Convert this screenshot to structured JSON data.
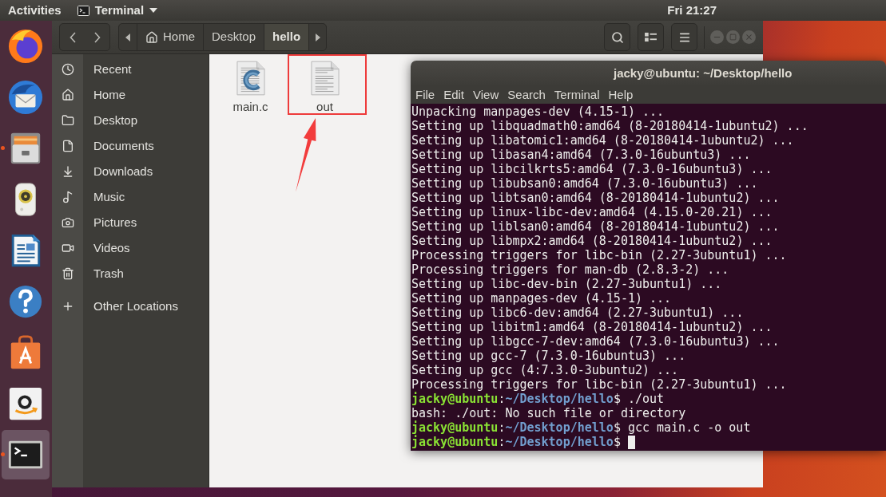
{
  "top_bar": {
    "activities": "Activities",
    "app_menu": "Terminal",
    "clock": "Fri 21:27"
  },
  "dock": {
    "items": [
      {
        "running": false,
        "selected": false
      },
      {
        "running": false,
        "selected": false
      },
      {
        "running": true,
        "selected": false
      },
      {
        "running": false,
        "selected": false
      },
      {
        "running": false,
        "selected": false
      },
      {
        "running": false,
        "selected": false
      },
      {
        "running": false,
        "selected": false
      },
      {
        "running": false,
        "selected": false
      },
      {
        "running": true,
        "selected": true
      }
    ]
  },
  "file_manager": {
    "path_bar": [
      {
        "kind": "home",
        "label": "Home",
        "selected": false
      },
      {
        "kind": "folder",
        "label": "Desktop",
        "selected": false
      },
      {
        "kind": "folder",
        "label": "hello",
        "selected": true
      }
    ],
    "sidebar": {
      "places": [
        "Recent",
        "Home",
        "Desktop",
        "Documents",
        "Downloads",
        "Music",
        "Pictures",
        "Videos",
        "Trash"
      ],
      "other_locations": "Other Locations"
    },
    "files": [
      {
        "name": "main.c",
        "kind": "c-source"
      },
      {
        "name": "out",
        "kind": "text"
      }
    ]
  },
  "terminal": {
    "title": "jacky@ubuntu: ~/Desktop/hello",
    "menu": [
      "File",
      "Edit",
      "View",
      "Search",
      "Terminal",
      "Help"
    ],
    "lines": [
      {
        "kind": "output",
        "text": "Unpacking manpages-dev (4.15-1) ..."
      },
      {
        "kind": "output",
        "text": "Setting up libquadmath0:amd64 (8-20180414-1ubuntu2) ..."
      },
      {
        "kind": "output",
        "text": "Setting up libatomic1:amd64 (8-20180414-1ubuntu2) ..."
      },
      {
        "kind": "output",
        "text": "Setting up libasan4:amd64 (7.3.0-16ubuntu3) ..."
      },
      {
        "kind": "output",
        "text": "Setting up libcilkrts5:amd64 (7.3.0-16ubuntu3) ..."
      },
      {
        "kind": "output",
        "text": "Setting up libubsan0:amd64 (7.3.0-16ubuntu3) ..."
      },
      {
        "kind": "output",
        "text": "Setting up libtsan0:amd64 (8-20180414-1ubuntu2) ..."
      },
      {
        "kind": "output",
        "text": "Setting up linux-libc-dev:amd64 (4.15.0-20.21) ..."
      },
      {
        "kind": "output",
        "text": "Setting up liblsan0:amd64 (8-20180414-1ubuntu2) ..."
      },
      {
        "kind": "output",
        "text": "Setting up libmpx2:amd64 (8-20180414-1ubuntu2) ..."
      },
      {
        "kind": "output",
        "text": "Processing triggers for libc-bin (2.27-3ubuntu1) ..."
      },
      {
        "kind": "output",
        "text": "Processing triggers for man-db (2.8.3-2) ..."
      },
      {
        "kind": "output",
        "text": "Setting up libc-dev-bin (2.27-3ubuntu1) ..."
      },
      {
        "kind": "output",
        "text": "Setting up manpages-dev (4.15-1) ..."
      },
      {
        "kind": "output",
        "text": "Setting up libc6-dev:amd64 (2.27-3ubuntu1) ..."
      },
      {
        "kind": "output",
        "text": "Setting up libitm1:amd64 (8-20180414-1ubuntu2) ..."
      },
      {
        "kind": "output",
        "text": "Setting up libgcc-7-dev:amd64 (7.3.0-16ubuntu3) ..."
      },
      {
        "kind": "output",
        "text": "Setting up gcc-7 (7.3.0-16ubuntu3) ..."
      },
      {
        "kind": "output",
        "text": "Setting up gcc (4:7.3.0-3ubuntu2) ..."
      },
      {
        "kind": "output",
        "text": "Processing triggers for libc-bin (2.27-3ubuntu1) ..."
      },
      {
        "kind": "prompt",
        "user": "jacky@ubuntu",
        "separator": ":",
        "path": "~/Desktop/hello",
        "symbol": "$",
        "command": "./out",
        "cursor": false
      },
      {
        "kind": "output",
        "text": "bash: ./out: No such file or directory"
      },
      {
        "kind": "prompt",
        "user": "jacky@ubuntu",
        "separator": ":",
        "path": "~/Desktop/hello",
        "symbol": "$",
        "command": "gcc main.c -o out",
        "cursor": false
      },
      {
        "kind": "prompt",
        "user": "jacky@ubuntu",
        "separator": ":",
        "path": "~/Desktop/hello",
        "symbol": "$",
        "cursor": true
      }
    ]
  }
}
